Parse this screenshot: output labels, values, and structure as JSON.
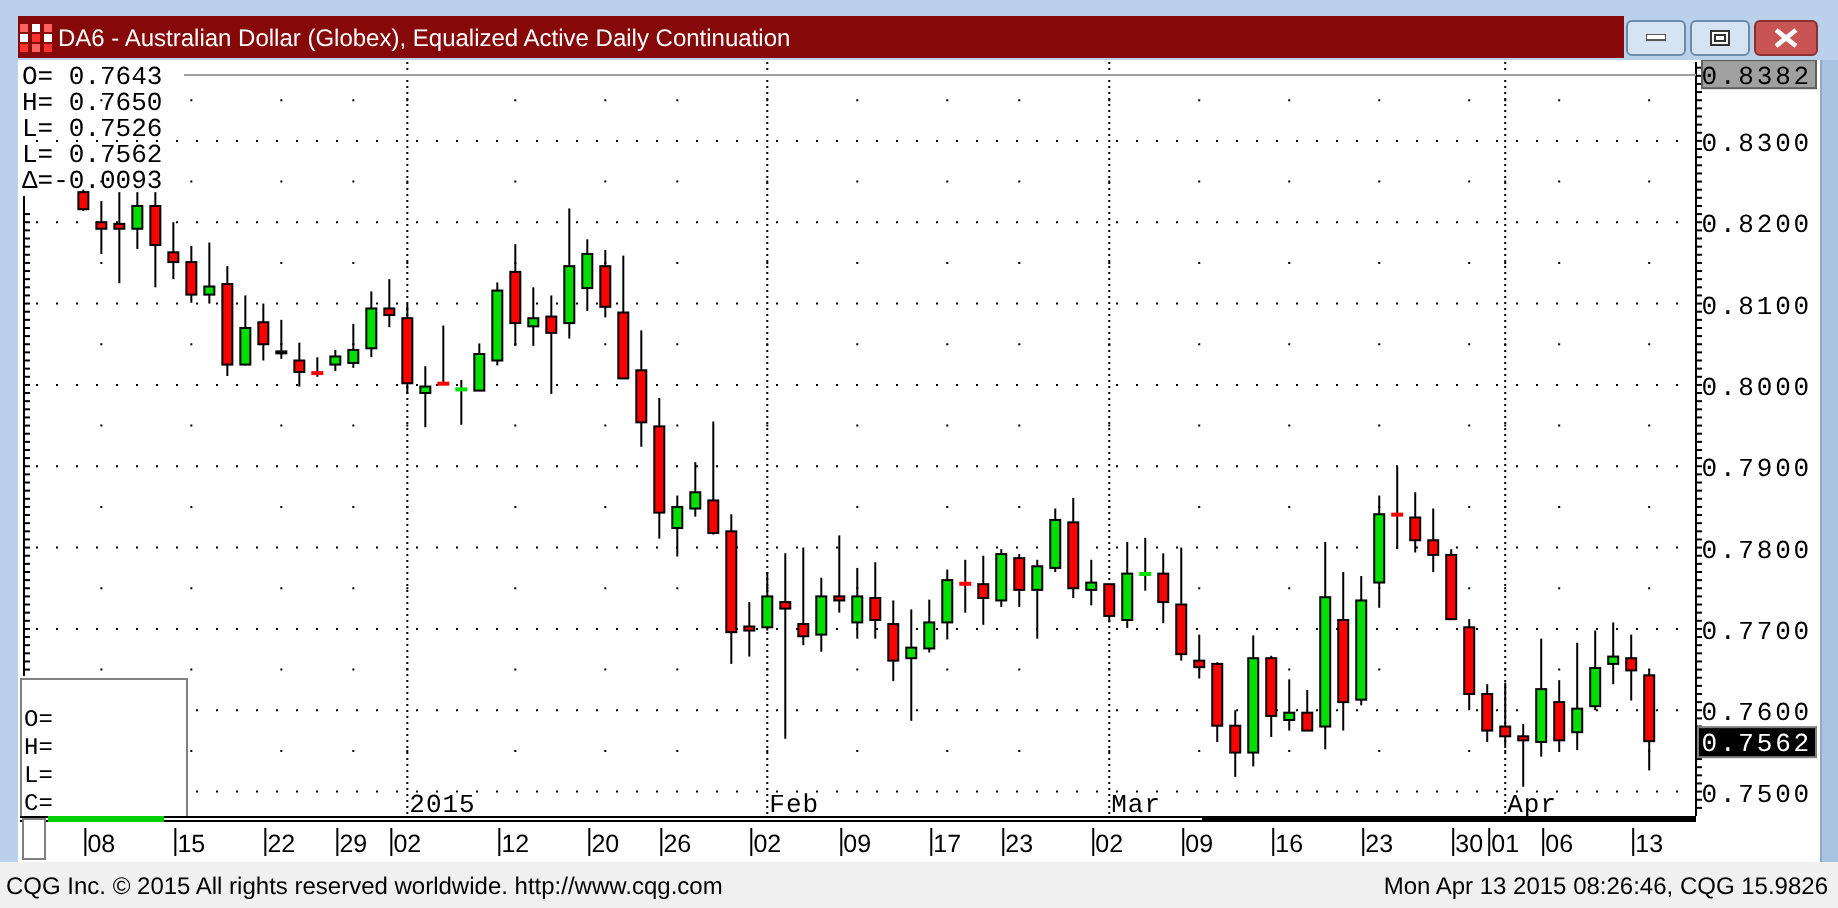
{
  "window": {
    "title": "DA6 - Australian Dollar (Globex), Equalized Active Daily Continuation"
  },
  "legend": [
    {
      "label": "O=",
      "value": "0.7643"
    },
    {
      "label": "H=",
      "value": "0.7650"
    },
    {
      "label": "L=",
      "value": "0.7526"
    },
    {
      "label": "L=",
      "value": "0.7562"
    },
    {
      "label": "Δ=",
      "value": "-0.0093"
    }
  ],
  "cursor_legend": [
    "O=",
    "H=",
    "L=",
    "C="
  ],
  "last_price": "0.7562",
  "chart_data": {
    "type": "candlestick",
    "grid": true,
    "ylim": [
      0.747,
      0.8397
    ],
    "categories": [
      null,
      "08",
      null,
      null,
      null,
      null,
      "15",
      null,
      null,
      null,
      null,
      "22",
      null,
      null,
      null,
      "29",
      null,
      null,
      "02",
      null,
      null,
      null,
      null,
      null,
      "12",
      null,
      null,
      null,
      null,
      "20",
      null,
      null,
      null,
      "26",
      null,
      null,
      null,
      null,
      "02",
      null,
      null,
      null,
      null,
      "09",
      null,
      null,
      null,
      null,
      "17",
      null,
      null,
      null,
      "23",
      null,
      null,
      null,
      null,
      "02",
      null,
      null,
      null,
      null,
      "09",
      null,
      null,
      null,
      null,
      "16",
      null,
      null,
      null,
      null,
      "23",
      null,
      null,
      null,
      null,
      "30",
      null,
      "01",
      null,
      null,
      "06",
      null,
      null,
      null,
      null,
      "13"
    ],
    "yticks": [
      {
        "value": 0.8382,
        "label": "0.8382"
      },
      {
        "value": 0.83,
        "label": "0.8300"
      },
      {
        "value": 0.82,
        "label": "0.8200"
      },
      {
        "value": 0.81,
        "label": "0.8100"
      },
      {
        "value": 0.8,
        "label": "0.8000"
      },
      {
        "value": 0.79,
        "label": "0.7900"
      },
      {
        "value": 0.78,
        "label": "0.7800"
      },
      {
        "value": 0.77,
        "label": "0.7700"
      },
      {
        "value": 0.76,
        "label": "0.7600"
      },
      {
        "value": 0.75,
        "label": "0.7500"
      }
    ],
    "annotations": [
      "2015",
      "Feb",
      "Mar",
      "Apr"
    ],
    "ohlc": [
      [
        0.8237,
        0.824,
        0.8214,
        0.8216
      ],
      [
        0.82,
        0.8226,
        0.8161,
        0.8192
      ],
      [
        0.8198,
        0.8237,
        0.8125,
        0.8192
      ],
      [
        0.8192,
        0.8237,
        0.8167,
        0.822
      ],
      [
        0.822,
        0.8237,
        0.812,
        0.8172
      ],
      [
        0.8163,
        0.82,
        0.813,
        0.8151
      ],
      [
        0.8151,
        0.8171,
        0.8101,
        0.8111
      ],
      [
        0.8111,
        0.8175,
        0.81,
        0.8121
      ],
      [
        0.8124,
        0.8146,
        0.8011,
        0.8025
      ],
      [
        0.8025,
        0.811,
        0.8024,
        0.807
      ],
      [
        0.8077,
        0.81,
        0.803,
        0.805
      ],
      [
        0.804,
        0.808,
        0.8032,
        0.804
      ],
      [
        0.803,
        0.8052,
        0.7998,
        0.8016
      ],
      [
        0.8015,
        0.8034,
        0.801,
        0.8014
      ],
      [
        0.8025,
        0.8043,
        0.8017,
        0.8035
      ],
      [
        0.8027,
        0.8075,
        0.8021,
        0.8043
      ],
      [
        0.8045,
        0.8115,
        0.8034,
        0.8094
      ],
      [
        0.8094,
        0.813,
        0.8071,
        0.8086
      ],
      [
        0.8082,
        0.81,
        0.7989,
        0.8002
      ],
      [
        0.799,
        0.8023,
        0.7948,
        0.7998
      ],
      [
        0.8002,
        0.8073,
        0.8001,
        0.8001
      ],
      [
        0.7994,
        0.8006,
        0.7951,
        0.7995
      ],
      [
        0.7993,
        0.8051,
        0.7993,
        0.8038
      ],
      [
        0.803,
        0.8126,
        0.8024,
        0.8116
      ],
      [
        0.8139,
        0.8173,
        0.8048,
        0.8076
      ],
      [
        0.8072,
        0.812,
        0.8048,
        0.8082
      ],
      [
        0.8084,
        0.811,
        0.7989,
        0.8064
      ],
      [
        0.8076,
        0.8217,
        0.8057,
        0.8146
      ],
      [
        0.8119,
        0.8179,
        0.8091,
        0.8161
      ],
      [
        0.8146,
        0.8166,
        0.8083,
        0.8096
      ],
      [
        0.8089,
        0.8159,
        0.8008,
        0.8008
      ],
      [
        0.8018,
        0.8067,
        0.7924,
        0.7954
      ],
      [
        0.7949,
        0.7984,
        0.7811,
        0.7843
      ],
      [
        0.7824,
        0.7864,
        0.7789,
        0.785
      ],
      [
        0.7848,
        0.7905,
        0.7838,
        0.7868
      ],
      [
        0.7858,
        0.7955,
        0.7816,
        0.7818
      ],
      [
        0.782,
        0.7841,
        0.7657,
        0.7696
      ],
      [
        0.7703,
        0.7733,
        0.7666,
        0.7698
      ],
      [
        0.7702,
        0.777,
        0.7698,
        0.774
      ],
      [
        0.7733,
        0.7793,
        0.7565,
        0.7725
      ],
      [
        0.7706,
        0.78,
        0.768,
        0.7691
      ],
      [
        0.7693,
        0.7763,
        0.7672,
        0.774
      ],
      [
        0.774,
        0.7815,
        0.772,
        0.7735
      ],
      [
        0.7708,
        0.7775,
        0.7688,
        0.774
      ],
      [
        0.7738,
        0.7782,
        0.7688,
        0.7711
      ],
      [
        0.7706,
        0.7735,
        0.7636,
        0.7661
      ],
      [
        0.7664,
        0.7724,
        0.7587,
        0.7677
      ],
      [
        0.7676,
        0.7736,
        0.7671,
        0.7708
      ],
      [
        0.7708,
        0.7773,
        0.7687,
        0.776
      ],
      [
        0.7756,
        0.7785,
        0.772,
        0.7755
      ],
      [
        0.7755,
        0.779,
        0.7705,
        0.7738
      ],
      [
        0.7735,
        0.7798,
        0.7727,
        0.7792
      ],
      [
        0.7787,
        0.7792,
        0.7727,
        0.7748
      ],
      [
        0.7748,
        0.7785,
        0.7688,
        0.7777
      ],
      [
        0.7775,
        0.7848,
        0.777,
        0.7834
      ],
      [
        0.7831,
        0.7861,
        0.7738,
        0.775
      ],
      [
        0.7748,
        0.7785,
        0.7729,
        0.7757
      ],
      [
        0.7755,
        0.7755,
        0.7708,
        0.7716
      ],
      [
        0.7711,
        0.7807,
        0.7701,
        0.7768
      ],
      [
        0.7767,
        0.7812,
        0.7747,
        0.7768
      ],
      [
        0.7768,
        0.7793,
        0.7707,
        0.7733
      ],
      [
        0.773,
        0.78,
        0.7661,
        0.7669
      ],
      [
        0.7661,
        0.7693,
        0.7639,
        0.7653
      ],
      [
        0.7657,
        0.7659,
        0.7561,
        0.7581
      ],
      [
        0.7581,
        0.76,
        0.7518,
        0.7548
      ],
      [
        0.7548,
        0.7692,
        0.7531,
        0.7664
      ],
      [
        0.7664,
        0.7667,
        0.7567,
        0.7593
      ],
      [
        0.7588,
        0.7638,
        0.7575,
        0.7597
      ],
      [
        0.7597,
        0.7625,
        0.7575,
        0.7575
      ],
      [
        0.758,
        0.7807,
        0.7552,
        0.7739
      ],
      [
        0.7711,
        0.777,
        0.7575,
        0.761
      ],
      [
        0.7613,
        0.7765,
        0.7606,
        0.7735
      ],
      [
        0.7757,
        0.7864,
        0.7726,
        0.7841
      ],
      [
        0.7841,
        0.7899,
        0.7798,
        0.784
      ],
      [
        0.7837,
        0.7868,
        0.7794,
        0.7809
      ],
      [
        0.7809,
        0.7848,
        0.777,
        0.7791
      ],
      [
        0.7791,
        0.7798,
        0.7712,
        0.7712
      ],
      [
        0.7702,
        0.7712,
        0.76,
        0.762
      ],
      [
        0.762,
        0.7632,
        0.7561,
        0.7575
      ],
      [
        0.758,
        0.7634,
        0.7556,
        0.7568
      ],
      [
        0.7568,
        0.7583,
        0.7506,
        0.7563
      ],
      [
        0.7561,
        0.7688,
        0.7543,
        0.7626
      ],
      [
        0.761,
        0.7637,
        0.7551,
        0.7563
      ],
      [
        0.7573,
        0.7683,
        0.7551,
        0.7602
      ],
      [
        0.7605,
        0.7698,
        0.76,
        0.7652
      ],
      [
        0.7657,
        0.7708,
        0.7632,
        0.7666
      ],
      [
        0.7664,
        0.7693,
        0.7612,
        0.7649
      ],
      [
        0.7643,
        0.765,
        0.7526,
        0.7562
      ]
    ]
  },
  "status_bar": {
    "left": "CQG Inc. © 2015 All rights reserved worldwide. http://www.cqg.com",
    "right": "Mon Apr 13 2015 08:26:46, CQG 15.9826"
  }
}
